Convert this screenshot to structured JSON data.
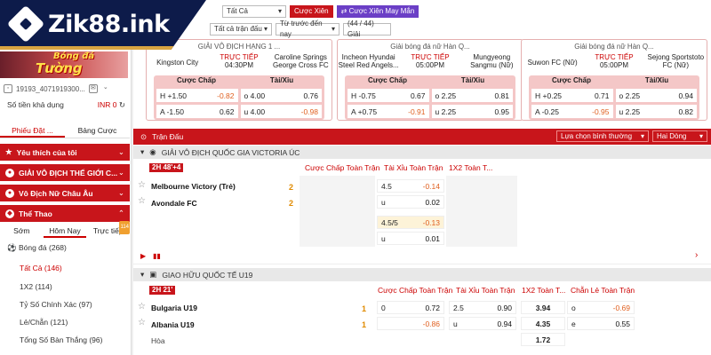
{
  "brand": {
    "logo_text": "Zik88.ink"
  },
  "sidebar": {
    "promo_text": "Tường Thuật",
    "promo_text2": "Bóng đá",
    "user_id": "19193_4071919300...",
    "balance_label": "Số tiền khả dụng",
    "balance_value": "INR 0",
    "bet_tabs": [
      "Phiếu Đặt ...",
      "Bảng Cược"
    ],
    "menus": [
      {
        "label": "Yêu thích của tôi"
      },
      {
        "label": "GIẢI VÔ ĐỊCH THẾ GIỚI C..."
      },
      {
        "label": "Vô Địch Nữ Châu Âu"
      },
      {
        "label": "Thể Thao"
      }
    ],
    "sport_tabs": [
      "Sớm",
      "Hôm Nay",
      "Trực tiếp"
    ],
    "live_badge": "114",
    "sport": "Bóng đá",
    "sport_count": "(268)",
    "subs": [
      {
        "label": "Tất Cả",
        "count": "(146)"
      },
      {
        "label": "1X2",
        "count": "(114)"
      },
      {
        "label": "Tỷ Số Chính Xác",
        "count": "(97)"
      },
      {
        "label": "Lẻ/Chẵn",
        "count": "(121)"
      },
      {
        "label": "Tổng Số Bàn Thắng",
        "count": "(96)"
      }
    ]
  },
  "filters": {
    "all": "Tất Cả",
    "bet_btn": "Cược Xiên",
    "random_btn": "Cược Xiên May Mắn",
    "all_matches": "Tất cả trận đấu",
    "from_early": "Từ trước đến nay",
    "league_count": "(44 / 44) Giải"
  },
  "cards": [
    {
      "league": "GIẢI VÔ ĐỊCH HẠNG 1 ...",
      "home": "Kingston City",
      "status": "TRỰC TIẾP",
      "time": "04:30PM",
      "away": "Caroline Springs George Cross FC",
      "hdp_label": "Cược Chấp",
      "ou_label": "Tài/Xỉu",
      "r1": {
        "h": "H",
        "hv": "+1.50",
        "ho": "-0.82",
        "o": "o",
        "ov": "4.00",
        "oo": "0.76"
      },
      "r2": {
        "h": "A",
        "hv": "-1.50",
        "ho": "0.62",
        "o": "u",
        "ov": "4.00",
        "oo": "-0.98"
      }
    },
    {
      "league": "Giải bóng đá nữ Hàn Q...",
      "home": "Incheon Hyundai Steel Red Angels...",
      "status": "TRỰC TIẾP",
      "time": "05:00PM",
      "away": "Mungyeong Sangmu (Nữ)",
      "hdp_label": "Cược Chấp",
      "ou_label": "Tài/Xỉu",
      "r1": {
        "h": "H",
        "hv": "-0.75",
        "ho": "0.67",
        "o": "o",
        "ov": "2.25",
        "oo": "0.81"
      },
      "r2": {
        "h": "A",
        "hv": "+0.75",
        "ho": "-0.91",
        "o": "u",
        "ov": "2.25",
        "oo": "0.95"
      }
    },
    {
      "league": "Giải bóng đá nữ Hàn Q...",
      "home": "Suwon FC (Nữ)",
      "status": "TRỰC TIẾP",
      "time": "05:00PM",
      "away": "Sejong Sportstoto FC (Nữ)",
      "hdp_label": "Cược Chấp",
      "ou_label": "Tài/Xỉu",
      "r1": {
        "h": "H",
        "hv": "+0.25",
        "ho": "0.71",
        "o": "o",
        "ov": "2.25",
        "oo": "0.94"
      },
      "r2": {
        "h": "A",
        "hv": "-0.25",
        "ho": "-0.95",
        "o": "u",
        "ov": "2.25",
        "oo": "0.82"
      }
    }
  ],
  "section": {
    "title": "Trận Đấu",
    "sort": "Lựa chọn bình thường",
    "lines": "Hai Dòng"
  },
  "league1": {
    "name": "GIẢI VÔ ĐỊCH QUỐC GIA VICTORIA ÚC",
    "col_hdp": "Cược Chấp Toàn Trận",
    "col_ou": "Tài Xỉu Toàn Trận",
    "col_1x2": "1X2 Toàn T...",
    "tag": "2H 48'+4",
    "home": "Melbourne Victory (Trẻ)",
    "away": "Avondale FC",
    "hs": "2",
    "as": "2",
    "o1": {
      "l": "4.5",
      "r": "-0.14"
    },
    "o2": {
      "l": "u",
      "r": "0.02"
    },
    "o3": {
      "l": "4.5/5",
      "r": "-0.13"
    },
    "o4": {
      "l": "u",
      "r": "0.01"
    }
  },
  "league2": {
    "name": "GIAO HỮU QUỐC TẾ U19",
    "col_hdp": "Cược Chấp Toàn Trận",
    "col_ou": "Tài Xỉu Toàn Trận",
    "col_1x2": "1X2 Toàn T...",
    "col_oe": "Chẵn Lẻ Toàn Trận",
    "tag": "2H 21'",
    "home": "Bulgaria U19",
    "away": "Albania U19",
    "draw": "Hòa",
    "hs": "1",
    "as": "1",
    "h1": {
      "l": "0",
      "r": "0.72"
    },
    "h2": {
      "l": "",
      "r": "-0.86"
    },
    "u1": {
      "l": "2.5",
      "r": "0.90"
    },
    "u2": {
      "l": "u",
      "r": "0.94"
    },
    "x1": "3.94",
    "x2": "4.35",
    "x3": "1.72",
    "e1": {
      "l": "o",
      "r": "-0.69"
    },
    "e2": {
      "l": "e",
      "r": "0.55"
    }
  }
}
